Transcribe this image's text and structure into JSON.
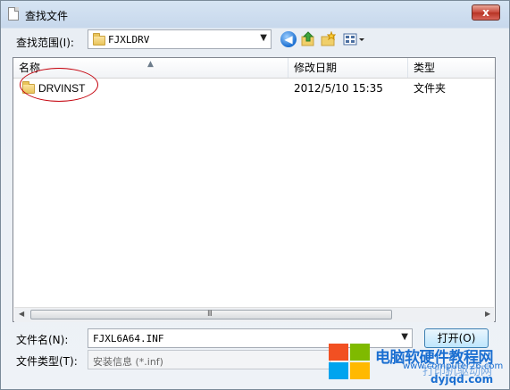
{
  "window": {
    "title": "查找文件",
    "close_glyph": "x"
  },
  "toolbar": {
    "look_in_label": "查找范围(I):",
    "look_in_value": "FJXLDRV",
    "icons": [
      "back-icon",
      "up-folder-icon",
      "new-folder-icon",
      "view-menu-icon"
    ]
  },
  "list": {
    "columns": {
      "name": "名称",
      "date": "修改日期",
      "type": "类型"
    },
    "rows": [
      {
        "name": "DRVINST",
        "date": "2012/5/10 15:35",
        "type": "文件夹"
      }
    ],
    "scroll_grip": "III"
  },
  "footer": {
    "filename_label": "文件名(N):",
    "filename_value": "FJXL6A64.INF",
    "filetype_label": "文件类型(T):",
    "filetype_value": "安装信息 (*.inf)",
    "open_label": "打开(O)"
  },
  "watermark": {
    "line1": "电脑软硬件教程网",
    "line2": "www.computer26.com",
    "line3": "打印机驱动网",
    "line4": "dyjqd.com"
  },
  "colors": {
    "accent": "#1b6fd1",
    "annotation": "#c4000b",
    "close": "#c8473a"
  }
}
